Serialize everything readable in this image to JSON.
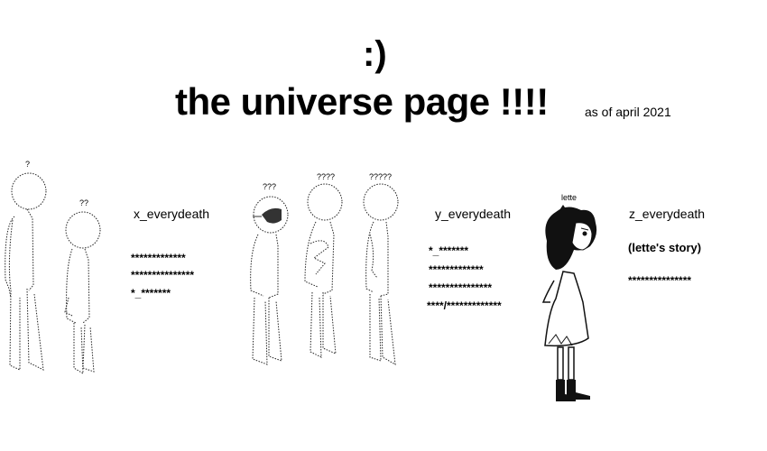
{
  "header": {
    "smiley": ":)",
    "title": "the universe page !!!!",
    "as_of": "as of april 2021"
  },
  "universes": [
    {
      "name": "x_everydeath",
      "figure_labels": [
        "?",
        "??"
      ],
      "links": [
        "*************",
        "***************",
        "*_*******"
      ]
    },
    {
      "name": "y_everydeath",
      "figure_labels": [
        "???",
        "????",
        "?????"
      ],
      "links": [
        "*_*******",
        "*************",
        "***************",
        "****/*************"
      ]
    },
    {
      "name": "z_everydeath",
      "figure_labels": [
        "lette"
      ],
      "links": [
        "(lette's story)",
        "***************"
      ]
    }
  ]
}
